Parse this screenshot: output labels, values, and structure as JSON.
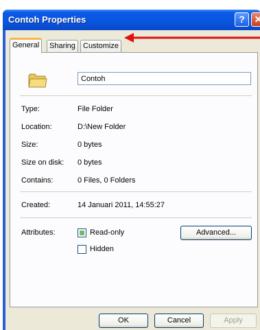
{
  "window": {
    "title": "Contoh Properties"
  },
  "tabs": [
    {
      "label": "General",
      "active": true
    },
    {
      "label": "Sharing",
      "active": false
    },
    {
      "label": "Customize",
      "active": false
    }
  ],
  "general": {
    "folder_name": "Contoh",
    "type_label": "Type:",
    "type_value": "File Folder",
    "location_label": "Location:",
    "location_value": "D:\\New Folder",
    "size_label": "Size:",
    "size_value": "0 bytes",
    "size_on_disk_label": "Size on disk:",
    "size_on_disk_value": "0 bytes",
    "contains_label": "Contains:",
    "contains_value": "0 Files, 0 Folders",
    "created_label": "Created:",
    "created_value": "14 Januari 2011, 14:55:27",
    "attributes_label": "Attributes:",
    "readonly_label": "Read-only",
    "readonly_checked": true,
    "hidden_label": "Hidden",
    "hidden_checked": false,
    "advanced_label": "Advanced..."
  },
  "buttons": {
    "ok": "OK",
    "cancel": "Cancel",
    "apply": "Apply"
  },
  "colors": {
    "titlebar": "#0a55de",
    "arrow": "#e01010",
    "face": "#ece9d8"
  }
}
